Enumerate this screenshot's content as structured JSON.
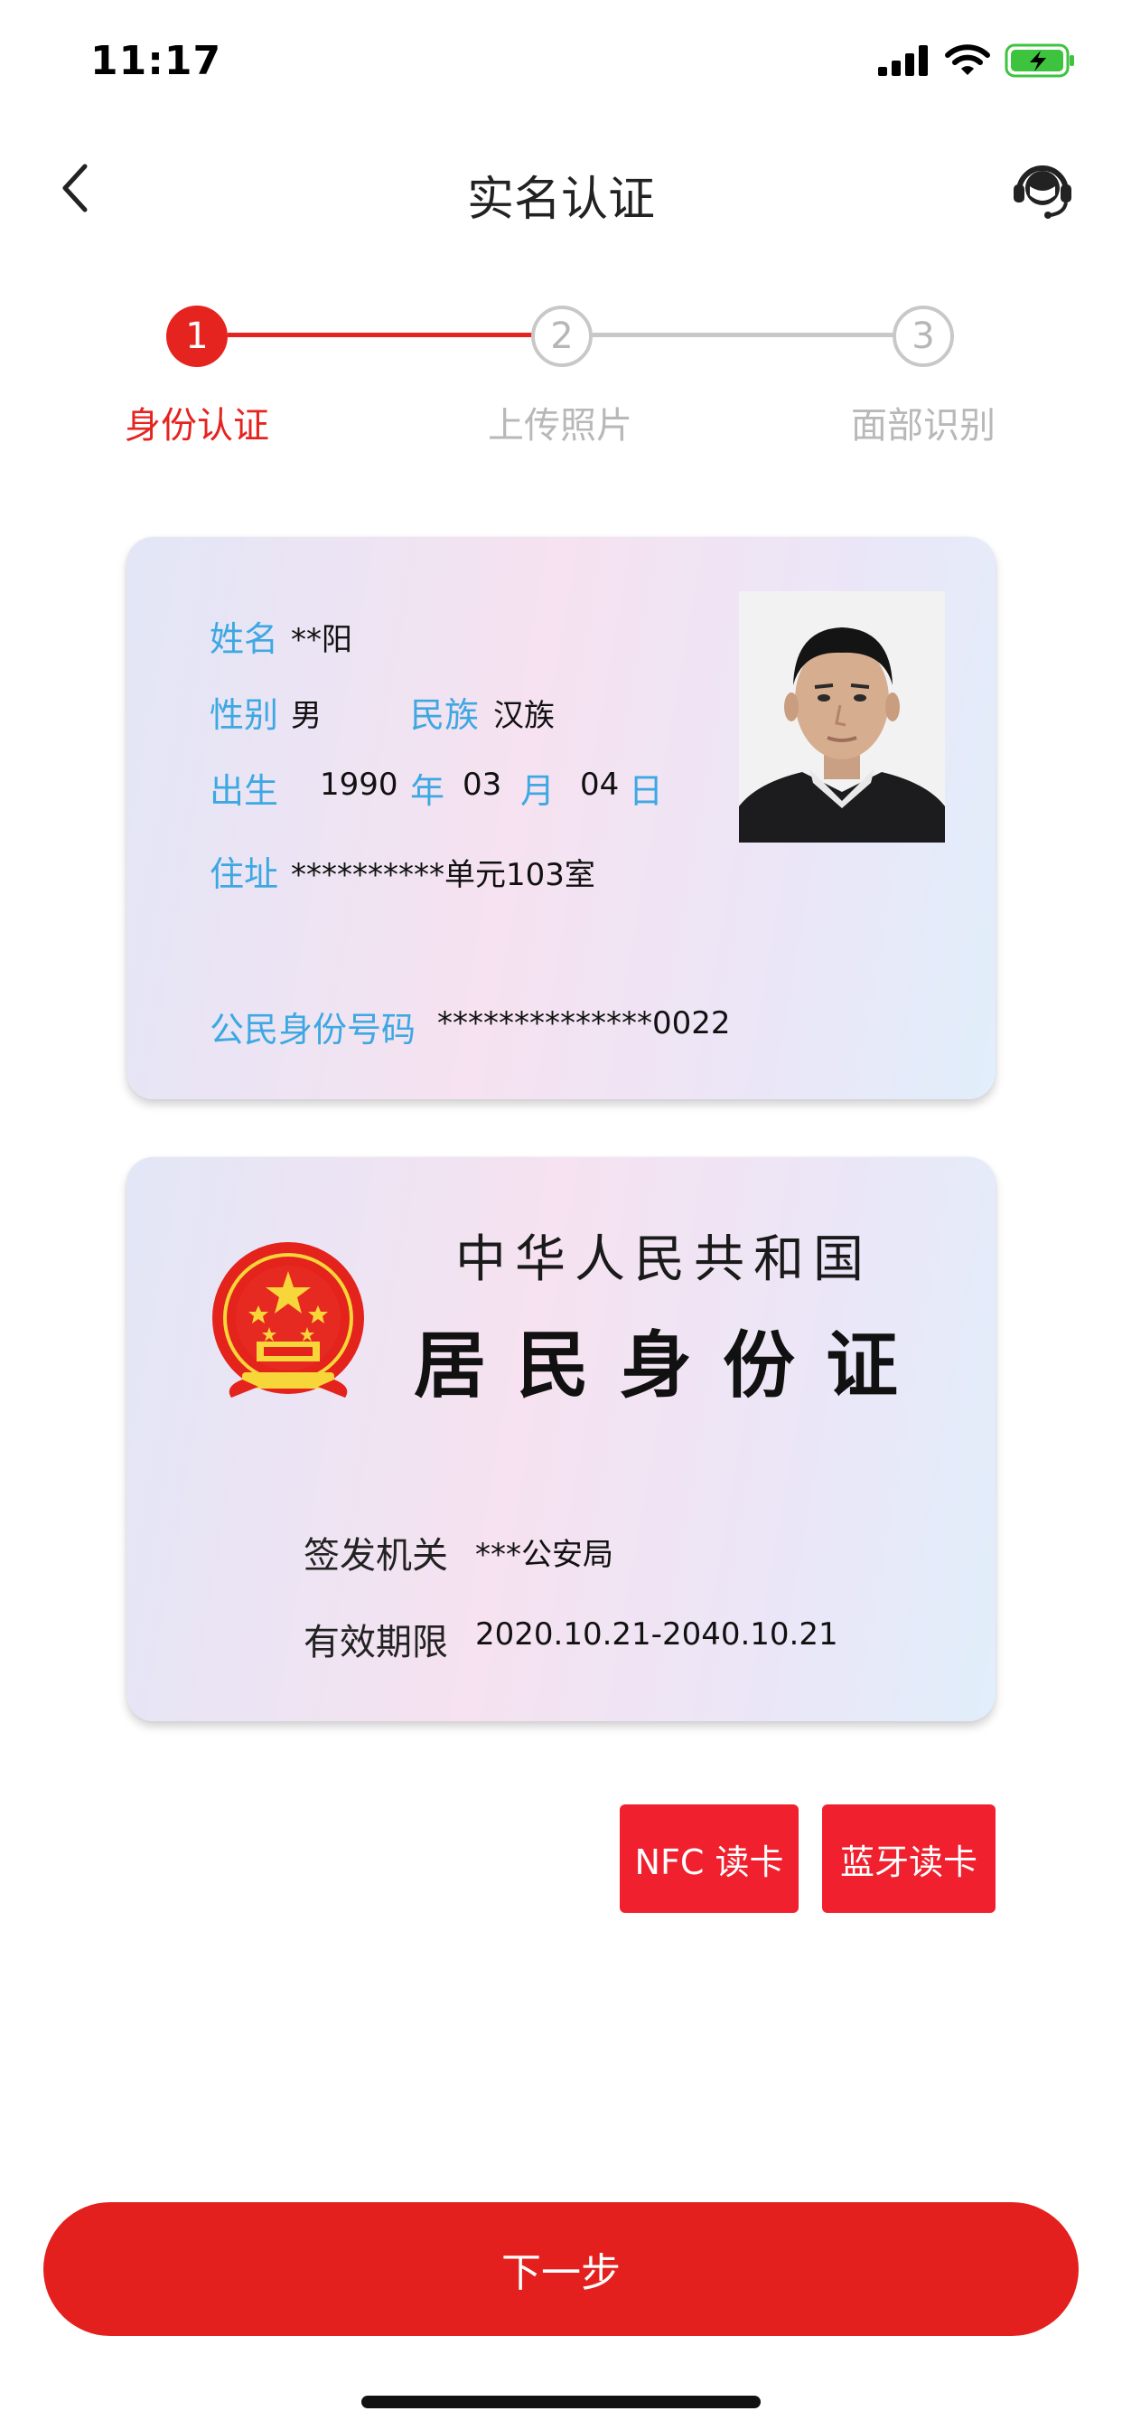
{
  "status_bar": {
    "time": "11:17"
  },
  "nav": {
    "title": "实名认证"
  },
  "steps": [
    {
      "number": "1",
      "label": "身份认证",
      "active": true
    },
    {
      "number": "2",
      "label": "上传照片",
      "active": false
    },
    {
      "number": "3",
      "label": "面部识别",
      "active": false
    }
  ],
  "id_front": {
    "name_label": "姓名",
    "name_value": "**阳",
    "sex_label": "性别",
    "sex_value": "男",
    "ethnic_label": "民族",
    "ethnic_value": "汉族",
    "birth_label": "出生",
    "birth_year": "1990",
    "year_label": "年",
    "birth_month": "03",
    "month_label": "月",
    "birth_day": "04",
    "day_label": "日",
    "address_label": "住址",
    "address_value": "**********单元103室",
    "id_label": "公民身份号码",
    "id_value": "**************0022"
  },
  "id_back": {
    "country": "中华人民共和国",
    "card_name": "居民身份证",
    "issuer_label": "签发机关",
    "issuer_value": "***公安局",
    "validity_label": "有效期限",
    "validity_value": "2020.10.21-2040.10.21"
  },
  "actions": {
    "nfc_label": "NFC 读卡",
    "bluetooth_label": "蓝牙读卡",
    "next_label": "下一步"
  },
  "colors": {
    "accent": "#e52420",
    "label_blue": "#3da8e2",
    "inactive_gray": "#b8b8b8"
  }
}
